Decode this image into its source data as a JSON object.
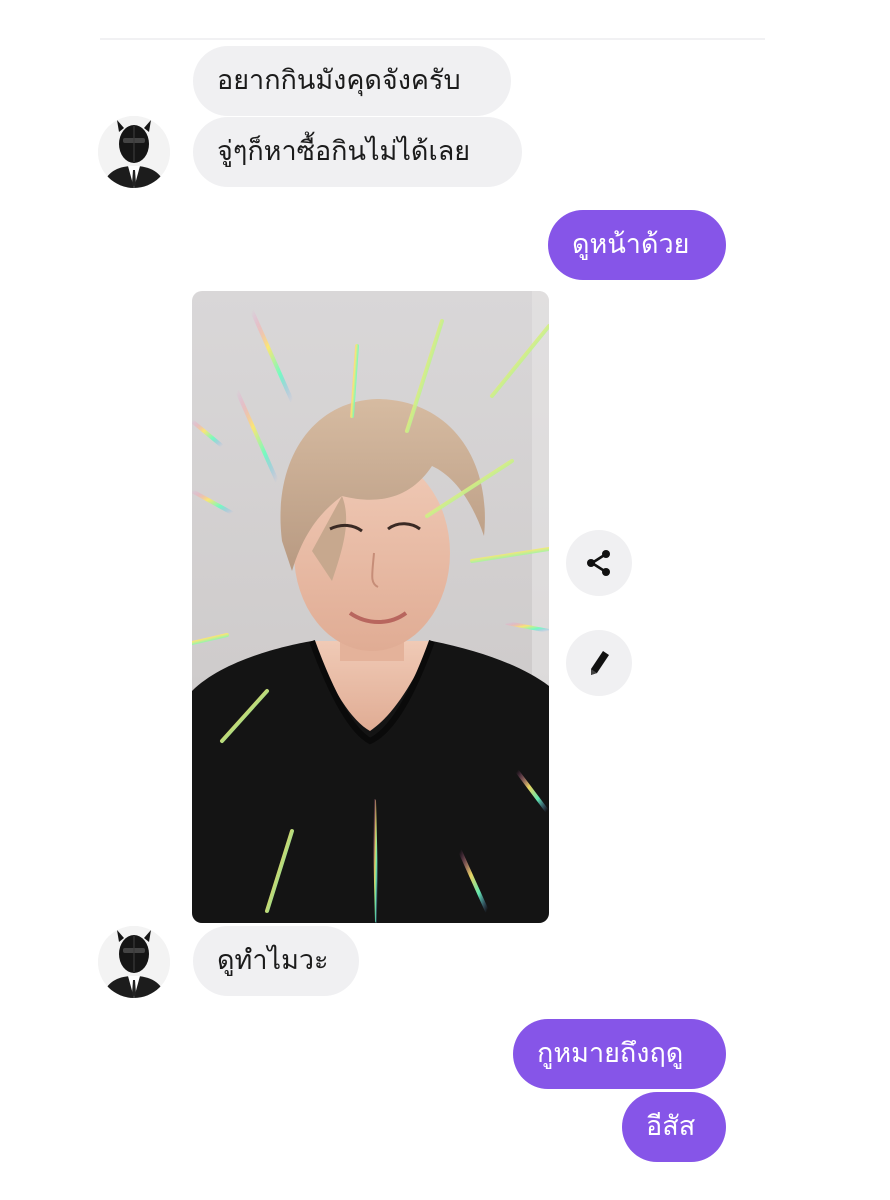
{
  "messages": [
    {
      "sender": "them",
      "text": "อยากกินมังคุดจังครับ"
    },
    {
      "sender": "them",
      "text": "จู่ๆก็หาซื้อกินไม่ได้เลย"
    },
    {
      "sender": "me",
      "text": "ดูหน้าด้วย"
    },
    {
      "sender": "them",
      "text": "ดูทำไมวะ"
    },
    {
      "sender": "me",
      "text": "กูหมายถึงฤดู"
    },
    {
      "sender": "me",
      "text": "อีสัส"
    }
  ],
  "colors": {
    "outgoing_bubble": "#8655e8",
    "incoming_bubble": "#f0f0f2",
    "incoming_text": "#1b1b1b",
    "outgoing_text": "#ffffff"
  },
  "icons": {
    "avatar": "masked-person-avatar",
    "share": "share-icon",
    "edit": "pencil-icon"
  },
  "photo_message": {
    "description_only": false
  }
}
